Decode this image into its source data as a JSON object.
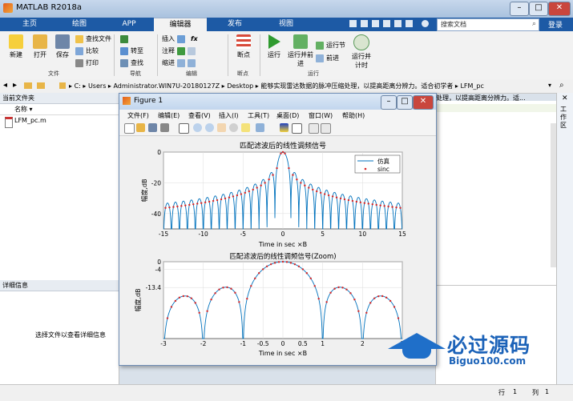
{
  "app": {
    "title": "MATLAB R2018a",
    "window_controls": [
      "–",
      "□",
      "✕"
    ],
    "tabs": [
      "主页",
      "绘图",
      "APP",
      "编辑器",
      "发布",
      "视图"
    ],
    "search_placeholder": "搜索文档",
    "login": "登录"
  },
  "ribbon": {
    "file": {
      "new": "新建",
      "open": "打开",
      "save": "保存",
      "find_files": "查找文件",
      "compare": "比较",
      "print": "打印",
      "group": "文件"
    },
    "nav": {
      "insert": "插入",
      "goto": "转至",
      "comment": "注释",
      "find": "查找",
      "indent": "缩进",
      "group": "导航"
    },
    "edit": {
      "group": "编辑"
    },
    "breakpoints": {
      "label": "断点",
      "group": "断点"
    },
    "run": {
      "run": "运行",
      "run_advance": "运行并前进",
      "run_section": "运行节",
      "advance": "前进",
      "run_time": "运行并计时",
      "group": "运行"
    }
  },
  "address": {
    "path": [
      "C:",
      "Users",
      "Administrator.WIN7U-20180127Z",
      "Desktop",
      "能够实现雷达数据的脉冲压缩处理，以提高距离分辨力。适合初学者",
      "LFM_pc"
    ]
  },
  "current_folder": {
    "title": "当前文件夹",
    "col_name": "名称",
    "files": [
      "LFM_pc.m"
    ]
  },
  "details": {
    "title": "详细信息",
    "hint": "选择文件以查看详细信息"
  },
  "editor_bg_text": "处理，以提高距离分辨力。适...",
  "right_strip_label": "工作区",
  "statusbar": {
    "row_label": "行",
    "row": "1",
    "col_label": "列",
    "col": "1"
  },
  "watermark": {
    "brand": "必过源码",
    "url": "Biguo100.com"
  },
  "figure": {
    "title": "Figure 1",
    "menus": [
      "文件(F)",
      "编辑(E)",
      "查看(V)",
      "插入(I)",
      "工具(T)",
      "桌面(D)",
      "窗口(W)",
      "帮助(H)"
    ],
    "plot1": {
      "title": "匹配滤波后的线性调频信号",
      "xlabel": "Time in sec ×B",
      "ylabel": "幅度,dB",
      "xticks": [
        "-15",
        "-10",
        "-5",
        "0",
        "5",
        "10",
        "15"
      ],
      "yticks": [
        "0",
        "-20",
        "-40"
      ],
      "legend": [
        "仿真",
        "sinc"
      ]
    },
    "plot2": {
      "title": "匹配滤波后的线性调频信号(Zoom)",
      "xlabel": "Time in sec ×B",
      "ylabel": "幅度,dB",
      "xticks": [
        "-3",
        "-2",
        "-1",
        "-0.5",
        "0",
        "0.5",
        "1",
        "2",
        "3"
      ],
      "yticks": [
        "0",
        "-4",
        "-13.4"
      ]
    }
  },
  "chart_data": [
    {
      "type": "line",
      "title": "匹配滤波后的线性调频信号",
      "xlabel": "Time in sec ×B",
      "ylabel": "幅度,dB",
      "xlim": [
        -15,
        15
      ],
      "ylim": [
        -50,
        0
      ],
      "grid": true,
      "legend_position": "top-right",
      "series": [
        {
          "name": "仿真",
          "style": "line",
          "color": "#0072bd",
          "function": "20*log10(|sinc(x)|)",
          "floor": -50
        },
        {
          "name": "sinc",
          "style": "points",
          "color": "#d62728",
          "x": [
            -14.75,
            -14.25,
            -13.75,
            -13.25,
            -12.75,
            -12.25,
            -11.75,
            -11.25,
            -10.75,
            -10.25,
            -9.75,
            -9.25,
            -8.75,
            -8.25,
            -7.75,
            -7.25,
            -6.75,
            -6.25,
            -5.75,
            -5.25,
            -4.75,
            -4.25,
            -3.75,
            -3.25,
            -2.75,
            -2.25,
            -1.75,
            -1.25,
            -0.75,
            -0.25,
            0,
            0.25,
            0.75,
            1.25,
            1.75,
            2.25,
            2.75,
            3.25,
            3.75,
            4.25,
            4.75,
            5.25,
            5.75,
            6.25,
            6.75,
            7.25,
            7.75,
            8.25,
            8.75,
            9.25,
            9.75,
            10.25,
            10.75,
            11.25,
            11.75,
            12.25,
            12.75,
            13.25,
            13.75,
            14.25,
            14.75
          ]
        }
      ]
    },
    {
      "type": "line",
      "title": "匹配滤波后的线性调频信号(Zoom)",
      "xlabel": "Time in sec ×B",
      "ylabel": "幅度,dB",
      "xlim": [
        -3,
        3
      ],
      "ylim": [
        -40,
        0
      ],
      "ytick_values": [
        0,
        -4,
        -13.4
      ],
      "grid": true,
      "series": [
        {
          "name": "仿真",
          "style": "line",
          "color": "#0072bd",
          "function": "20*log10(|sinc(x)|)",
          "floor": -40
        },
        {
          "name": "sinc",
          "style": "points",
          "color": "#d62728",
          "x": [
            -2.9,
            -2.8,
            -2.7,
            -2.6,
            -2.5,
            -2.4,
            -2.3,
            -2.2,
            -2.1,
            -1.9,
            -1.8,
            -1.7,
            -1.6,
            -1.5,
            -1.4,
            -1.3,
            -1.2,
            -1.1,
            -0.9,
            -0.8,
            -0.7,
            -0.6,
            -0.5,
            -0.4,
            -0.3,
            -0.2,
            -0.1,
            0,
            0.1,
            0.2,
            0.3,
            0.4,
            0.5,
            0.6,
            0.7,
            0.8,
            0.9,
            1.1,
            1.2,
            1.3,
            1.4,
            1.5,
            1.6,
            1.7,
            1.8,
            1.9,
            2.1,
            2.2,
            2.3,
            2.4,
            2.5,
            2.6,
            2.7,
            2.8,
            2.9
          ]
        }
      ]
    }
  ],
  "colors": {
    "tabbar": "#1d5aa5",
    "line": "#0072bd",
    "points": "#d62728"
  }
}
